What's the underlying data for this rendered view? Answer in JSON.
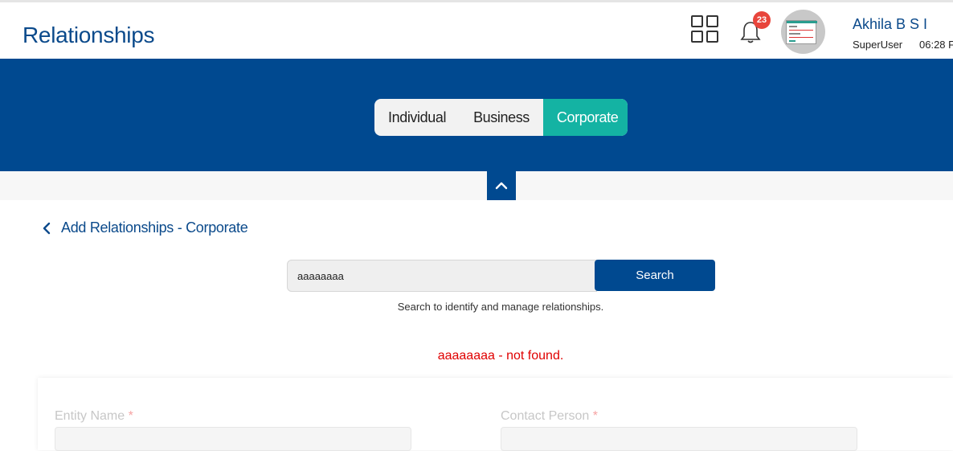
{
  "header": {
    "title": "Relationships",
    "notifications_count": "23",
    "user": {
      "name": "Akhila B S I",
      "role": "SuperUser",
      "time": "06:28 F"
    }
  },
  "tabs": [
    {
      "label": "Individual",
      "active": false
    },
    {
      "label": "Business",
      "active": false
    },
    {
      "label": "Corporate",
      "active": true
    }
  ],
  "page": {
    "back_label": "Add Relationships - Corporate"
  },
  "search": {
    "value": "aaaaaaaa",
    "button_label": "Search",
    "hint": "Search to identify and manage relationships.",
    "error": "aaaaaaaa - not found."
  },
  "form": {
    "entity_name_label": "Entity Name",
    "contact_person_label": "Contact Person",
    "required_mark": "*"
  },
  "colors": {
    "brand": "#004990",
    "accent": "#14b3a3",
    "error": "#e00000",
    "badge": "#e8453c"
  }
}
